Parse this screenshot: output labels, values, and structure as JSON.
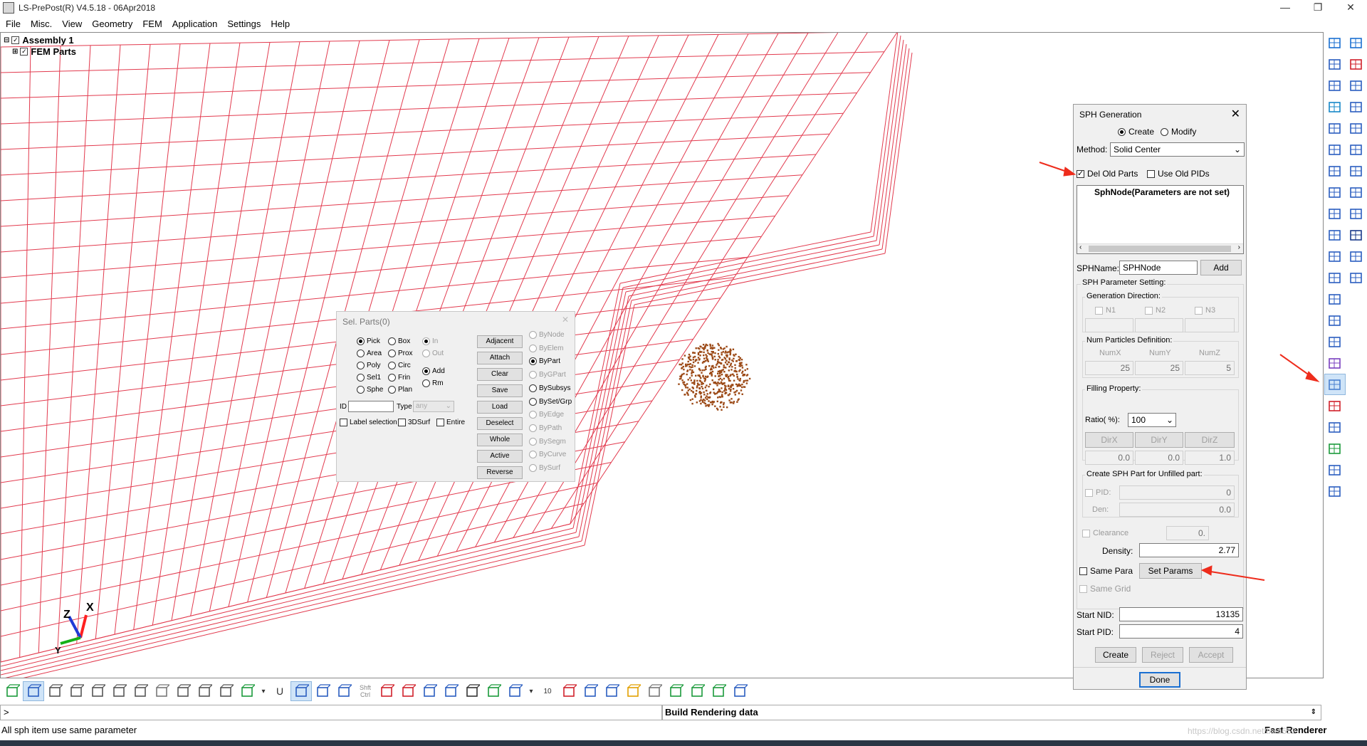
{
  "window": {
    "title": "LS-PrePost(R) V4.5.18 - 06Apr2018",
    "minimize": "—",
    "restore": "❐",
    "close": "✕"
  },
  "menu": [
    "File",
    "Misc.",
    "View",
    "Geometry",
    "FEM",
    "Application",
    "Settings",
    "Help"
  ],
  "tree": {
    "assembly": "Assembly 1",
    "parts": "FEM Parts"
  },
  "axes": {
    "x": "X",
    "y": "Y",
    "z": "Z"
  },
  "colors": {
    "mesh": "#e23a4e",
    "particles": "#9c4a17",
    "arrow": "#ee2c1c",
    "accent": "#1a6fd1"
  },
  "sel_parts": {
    "title": "Sel. Parts(0)",
    "modes": [
      [
        "Pick",
        "Box"
      ],
      [
        "Area",
        "Prox"
      ],
      [
        "Poly",
        "Circ"
      ],
      [
        "Sel1",
        "Frin"
      ],
      [
        "Sphe",
        "Plan"
      ]
    ],
    "in_label": "In",
    "out_label": "Out",
    "add_label": "Add",
    "rm_label": "Rm",
    "id_label": "ID",
    "type_label": "Type",
    "type_value": "any",
    "label_selection": "Label selection",
    "surf3d": "3DSurf",
    "entire": "Entire",
    "buttons": [
      "Adjacent",
      "Attach",
      "Clear",
      "Save",
      "Load",
      "Deselect",
      "Whole",
      "Active",
      "Reverse"
    ],
    "by_options": [
      {
        "label": "ByNode",
        "enabled": false
      },
      {
        "label": "ByElem",
        "enabled": false
      },
      {
        "label": "ByPart",
        "enabled": true
      },
      {
        "label": "ByGPart",
        "enabled": false
      },
      {
        "label": "BySubsys",
        "enabled": true
      },
      {
        "label": "BySet/Grp",
        "enabled": true
      },
      {
        "label": "ByEdge",
        "enabled": false
      },
      {
        "label": "ByPath",
        "enabled": false
      },
      {
        "label": "BySegm",
        "enabled": false
      },
      {
        "label": "ByCurve",
        "enabled": false
      },
      {
        "label": "BySurf",
        "enabled": false
      }
    ]
  },
  "sph": {
    "title": "SPH Generation",
    "create_label": "Create",
    "modify_label": "Modify",
    "method_label": "Method:",
    "method_value": "Solid Center",
    "del_old_parts": "Del Old Parts",
    "use_old_pids": "Use Old PIDs",
    "list_item": "SphNode(Parameters are not set)",
    "sphname_label": "SPHName:",
    "sphname_value": "SPHNode",
    "add_label": "Add",
    "param_setting": "SPH Parameter Setting:",
    "gen_direction": "Generation Direction:",
    "n1": "N1",
    "n2": "N2",
    "n3": "N3",
    "num_particles": "Num Particles Definition:",
    "numx": "NumX",
    "numy": "NumY",
    "numz": "NumZ",
    "numx_val": "25",
    "numy_val": "25",
    "numz_val": "5",
    "filling": "Filling Property:",
    "ratio_label": "Ratio( %):",
    "ratio_value": "100",
    "dirx": "DirX",
    "diry": "DirY",
    "dirz": "DirZ",
    "dirx_val": "0.0",
    "diry_val": "0.0",
    "dirz_val": "1.0",
    "unfilled": "Create SPH Part for Unfilled part:",
    "pid_label": "PID:",
    "pid_val": "0",
    "den_label": "Den:",
    "den_val": "0.0",
    "clearance_label": "Clearance",
    "clearance_val": "0.",
    "density_label": "Density:",
    "density_val": "2.77",
    "same_para": "Same Para",
    "set_params": "Set Params",
    "same_grid": "Same Grid",
    "start_nid_label": "Start NID:",
    "start_nid_val": "13135",
    "start_pid_label": "Start PID:",
    "start_pid_val": "4",
    "create_btn": "Create",
    "reject_btn": "Reject",
    "accept_btn": "Accept",
    "done_btn": "Done"
  },
  "bottom": {
    "shft_ctrl": "Shft Ctrl",
    "u_label": "U",
    "ten": "10"
  },
  "cmdline": ">",
  "build_msg": "Build Rendering data",
  "status": {
    "left": "All sph item use same parameter",
    "right": "Fast Renderer"
  },
  "watermark": "https://blog.csdn.net/lxx4652"
}
